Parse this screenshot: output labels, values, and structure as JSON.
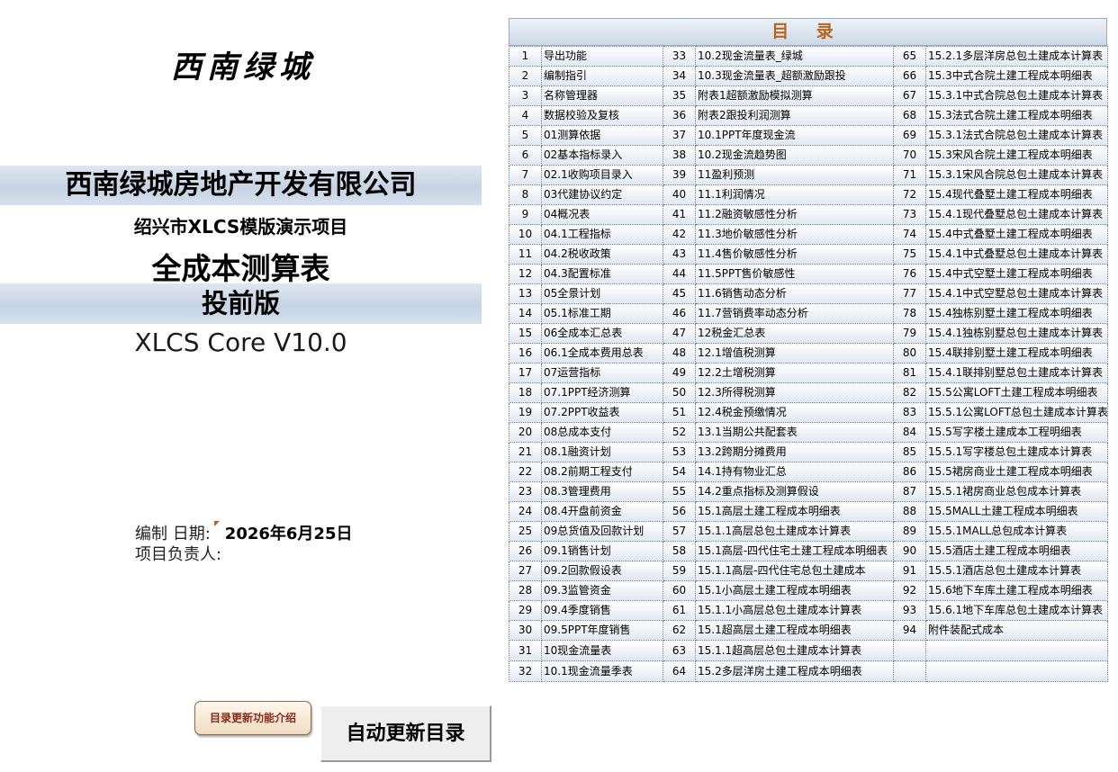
{
  "left": {
    "brand": "西南绿城",
    "company": "西南绿城房地产开发有限公司",
    "project": "绍兴市XLCS模版演示项目",
    "title": "全成本测算表",
    "version": "投前版",
    "core": "XLCS Core V10.0",
    "compile_date_label": "编制   日期:",
    "compile_date_value": "2026年6月25日",
    "project_leader_label": "项目负责人:"
  },
  "buttons": {
    "intro": "目录更新功能介绍",
    "update": "自动更新目录"
  },
  "toc": {
    "title": "目 录",
    "rows": [
      [
        [
          "1",
          "导出功能"
        ],
        [
          "33",
          "10.2现金流量表_绿城"
        ],
        [
          "65",
          "15.2.1多层洋房总包土建成本计算表"
        ]
      ],
      [
        [
          "2",
          "编制指引"
        ],
        [
          "34",
          "10.3现金流量表_超额激励跟投"
        ],
        [
          "66",
          "15.3中式合院土建工程成本明细表"
        ]
      ],
      [
        [
          "3",
          "名称管理器"
        ],
        [
          "35",
          "附表1超额激励模拟测算"
        ],
        [
          "67",
          "15.3.1中式合院总包土建成本计算表"
        ]
      ],
      [
        [
          "4",
          "数据校验及复核"
        ],
        [
          "36",
          "附表2跟投利润测算"
        ],
        [
          "68",
          "15.3法式合院土建工程成本明细表"
        ]
      ],
      [
        [
          "5",
          "01测算依据"
        ],
        [
          "37",
          "10.1PPT年度现金流"
        ],
        [
          "69",
          "15.3.1法式合院总包土建成本计算表"
        ]
      ],
      [
        [
          "6",
          "02基本指标录入"
        ],
        [
          "38",
          "10.2现金流趋势图"
        ],
        [
          "70",
          "15.3宋风合院土建工程成本明细表"
        ]
      ],
      [
        [
          "7",
          "02.1收购项目录入"
        ],
        [
          "39",
          "11盈利预测"
        ],
        [
          "71",
          "15.3.1宋风合院总包土建成本计算表"
        ]
      ],
      [
        [
          "8",
          "03代建协议约定"
        ],
        [
          "40",
          "11.1利润情况"
        ],
        [
          "72",
          "15.4现代叠墅土建工程成本明细表"
        ]
      ],
      [
        [
          "9",
          "04概况表"
        ],
        [
          "41",
          "11.2融资敏感性分析"
        ],
        [
          "73",
          "15.4.1现代叠墅总包土建成本计算表"
        ]
      ],
      [
        [
          "10",
          "04.1工程指标"
        ],
        [
          "42",
          "11.3地价敏感性分析"
        ],
        [
          "74",
          "15.4中式叠墅土建工程成本明细表"
        ]
      ],
      [
        [
          "11",
          "04.2税收政策"
        ],
        [
          "43",
          "11.4售价敏感性分析"
        ],
        [
          "75",
          "15.4.1中式叠墅总包土建成本计算表"
        ]
      ],
      [
        [
          "12",
          "04.3配置标准"
        ],
        [
          "44",
          "11.5PPT售价敏感性"
        ],
        [
          "76",
          "15.4中式空墅土建工程成本明细表"
        ]
      ],
      [
        [
          "13",
          "05全景计划"
        ],
        [
          "45",
          "11.6销售动态分析"
        ],
        [
          "77",
          "15.4.1中式空墅总包土建成本计算表"
        ]
      ],
      [
        [
          "14",
          "05.1标准工期"
        ],
        [
          "46",
          "11.7营销费率动态分析"
        ],
        [
          "78",
          "15.4独栋别墅土建工程成本明细表"
        ]
      ],
      [
        [
          "15",
          "06全成本汇总表"
        ],
        [
          "47",
          "12税金汇总表"
        ],
        [
          "79",
          "15.4.1独栋别墅总包土建成本计算表"
        ]
      ],
      [
        [
          "16",
          "06.1全成本费用总表"
        ],
        [
          "48",
          "12.1增值税测算"
        ],
        [
          "80",
          "15.4联排别墅土建工程成本明细表"
        ]
      ],
      [
        [
          "17",
          "07运营指标"
        ],
        [
          "49",
          "12.2土增税测算"
        ],
        [
          "81",
          "15.4.1联排别墅总包土建成本计算表"
        ]
      ],
      [
        [
          "18",
          "07.1PPT经济测算"
        ],
        [
          "50",
          "12.3所得税测算"
        ],
        [
          "82",
          "15.5公寓LOFT土建工程成本明细表"
        ]
      ],
      [
        [
          "19",
          "07.2PPT收益表"
        ],
        [
          "51",
          "12.4税金预缴情况"
        ],
        [
          "83",
          "15.5.1公寓LOFT总包土建成本计算表"
        ]
      ],
      [
        [
          "20",
          "08总成本支付"
        ],
        [
          "52",
          "13.1当期公共配套表"
        ],
        [
          "84",
          "15.5写字楼土建成本工程明细表"
        ]
      ],
      [
        [
          "21",
          "08.1融资计划"
        ],
        [
          "53",
          "13.2跨期分摊费用"
        ],
        [
          "85",
          "15.5.1写字楼总包土建成本计算表"
        ]
      ],
      [
        [
          "22",
          "08.2前期工程支付"
        ],
        [
          "54",
          "14.1持有物业汇总"
        ],
        [
          "86",
          "15.5裙房商业土建工程成本明细表"
        ]
      ],
      [
        [
          "23",
          "08.3管理费用"
        ],
        [
          "55",
          "14.2重点指标及测算假设"
        ],
        [
          "87",
          "15.5.1裙房商业总包成本计算表"
        ]
      ],
      [
        [
          "24",
          "08.4开盘前资金"
        ],
        [
          "56",
          "15.1高层土建工程成本明细表"
        ],
        [
          "88",
          "15.5MALL土建工程成本明细表"
        ]
      ],
      [
        [
          "25",
          "09总货值及回款计划"
        ],
        [
          "57",
          "15.1.1高层总包土建成本计算表"
        ],
        [
          "89",
          "15.5.1MALL总包成本计算表"
        ]
      ],
      [
        [
          "26",
          "09.1销售计划"
        ],
        [
          "58",
          "15.1高层-四代住宅土建工程成本明细表"
        ],
        [
          "90",
          "15.5酒店土建工程成本明细表"
        ]
      ],
      [
        [
          "27",
          "09.2回款假设表"
        ],
        [
          "59",
          "15.1.1高层-四代住宅总包土建成本"
        ],
        [
          "91",
          "15.5.1酒店总包土建成本计算表"
        ]
      ],
      [
        [
          "28",
          "09.3监管资金"
        ],
        [
          "60",
          "15.1小高层土建工程成本明细表"
        ],
        [
          "92",
          "15.6地下车库土建工程成本明细表"
        ]
      ],
      [
        [
          "29",
          "09.4季度销售"
        ],
        [
          "61",
          "15.1.1小高层总包土建成本计算表"
        ],
        [
          "93",
          "15.6.1地下车库总包土建成本计算表"
        ]
      ],
      [
        [
          "30",
          "09.5PPT年度销售"
        ],
        [
          "62",
          "15.1超高层土建工程成本明细表"
        ],
        [
          "94",
          "附件装配式成本"
        ]
      ],
      [
        [
          "31",
          "10现金流量表"
        ],
        [
          "63",
          "15.1.1超高层总包土建成本计算表"
        ],
        [
          "",
          ""
        ]
      ],
      [
        [
          "32",
          "10.1现金流量季表"
        ],
        [
          "64",
          "15.2多层洋房土建工程成本明细表"
        ],
        [
          "",
          ""
        ]
      ]
    ]
  }
}
